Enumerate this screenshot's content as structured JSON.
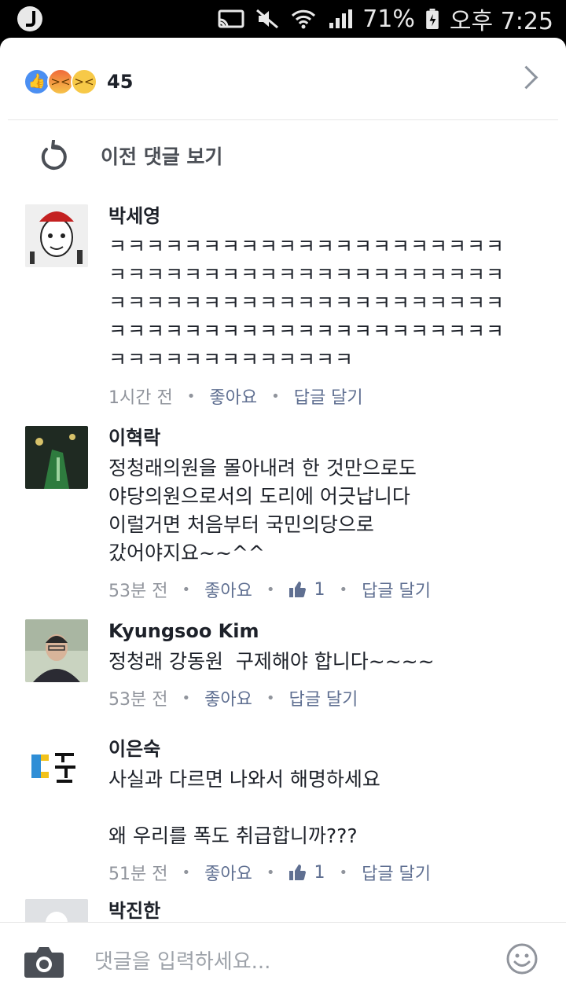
{
  "status_bar": {
    "battery": "71%",
    "time": "오후 7:25"
  },
  "reactions": {
    "count": "45"
  },
  "previous": {
    "label": "이전 댓글 보기"
  },
  "comments": [
    {
      "author": "박세영",
      "text": "ㅋㅋㅋㅋㅋㅋㅋㅋㅋㅋㅋㅋㅋㅋㅋㅋㅋㅋㅋㅋㅋㅋㅋㅋㅋㅋㅋㅋㅋㅋㅋㅋㅋㅋㅋㅋㅋㅋㅋㅋㅋㅋㅋㅋㅋㅋㅋㅋㅋㅋㅋㅋㅋㅋㅋㅋㅋㅋㅋㅋㅋㅋㅋㅋㅋㅋㅋㅋㅋㅋㅋㅋㅋㅋㅋㅋㅋㅋㅋㅋㅋㅋㅋㅋㅋㅋㅋㅋㅋㅋㅋㅋㅋㅋㅋㅋㅋ",
      "time": "1시간 전",
      "like": "좋아요",
      "reply": "답글 달기"
    },
    {
      "author": "이혁락",
      "text": "정청래의원을 몰아내려 한 것만으로도\n야당의원으로서의 도리에 어긋납니다\n이럴거면 처음부터 국민의당으로\n갔어야지요~~^^",
      "time": "53분 전",
      "like": "좋아요",
      "like_count": "1",
      "reply": "답글 달기"
    },
    {
      "author": "Kyungsoo Kim",
      "text": "정청래 강동원  구제해야 합니다~~~~",
      "time": "53분 전",
      "like": "좋아요",
      "reply": "답글 달기"
    },
    {
      "author": "이은숙",
      "text": "사실과 다르면 나와서 해명하세요\n\n왜 우리를 폭도 취급합니까???",
      "time": "51분 전",
      "like": "좋아요",
      "like_count": "1",
      "reply": "답글 달기"
    },
    {
      "author": "박진한"
    }
  ],
  "composer": {
    "placeholder": "댓글을 입력하세요..."
  }
}
